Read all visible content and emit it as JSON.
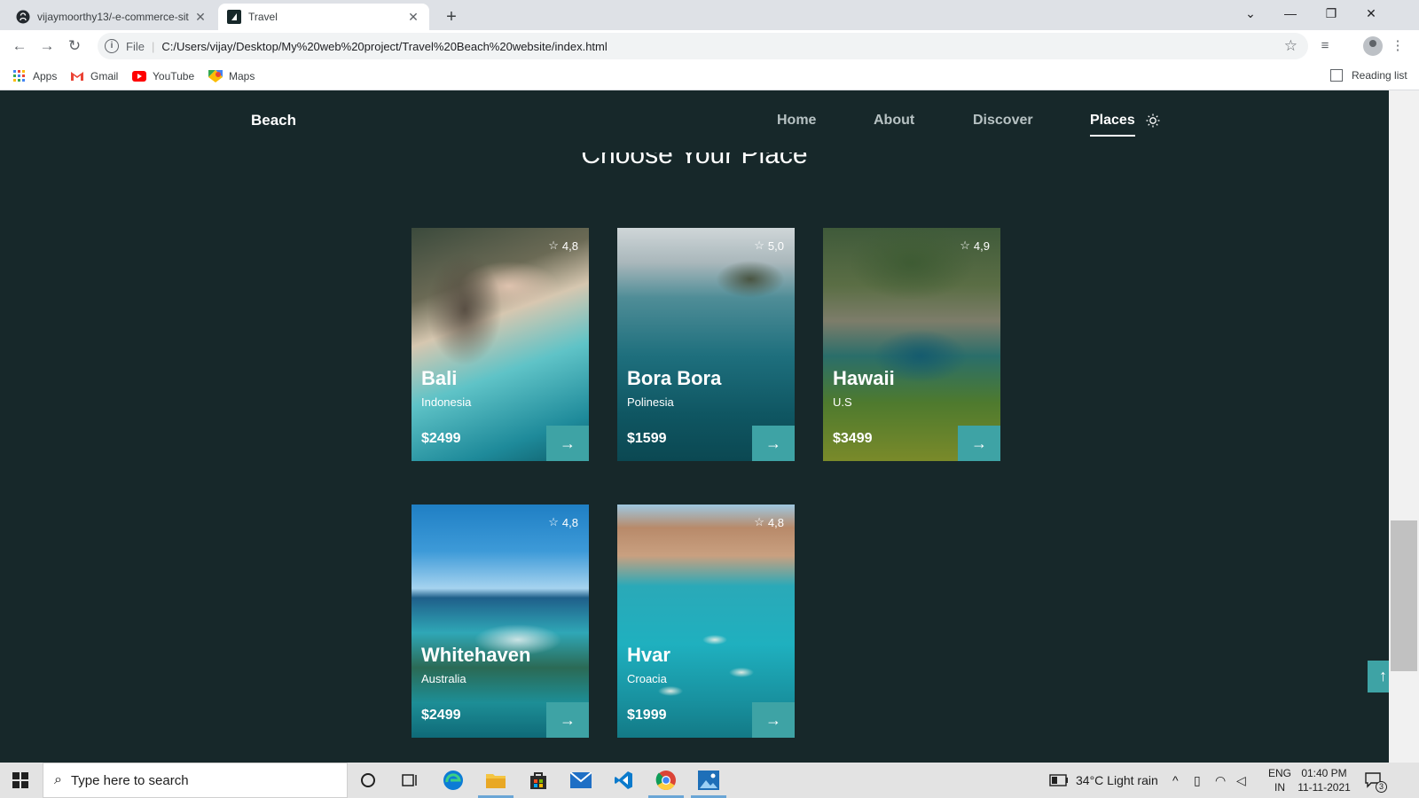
{
  "browser": {
    "tabs": [
      {
        "title": "vijaymoorthy13/-e-commerce-sit",
        "icon": "github-icon"
      },
      {
        "title": "Travel",
        "icon": "site-icon"
      }
    ],
    "address": {
      "protocol": "File",
      "url": "C:/Users/vijay/Desktop/My%20web%20project/Travel%20Beach%20website/index.html"
    },
    "bookmarks": [
      {
        "label": "Apps",
        "icon": "apps-grid-icon"
      },
      {
        "label": "Gmail",
        "icon": "gmail-icon"
      },
      {
        "label": "YouTube",
        "icon": "youtube-icon"
      },
      {
        "label": "Maps",
        "icon": "maps-icon"
      }
    ],
    "reading_list": "Reading list"
  },
  "site": {
    "logo": "Beach",
    "nav": [
      {
        "label": "Home",
        "active": false
      },
      {
        "label": "About",
        "active": false
      },
      {
        "label": "Discover",
        "active": false
      },
      {
        "label": "Places",
        "active": true
      }
    ],
    "section_title": "Choose Your Place",
    "accent_color": "#3ea3a5",
    "background_color": "#17282a",
    "places": [
      {
        "name": "Bali",
        "country": "Indonesia",
        "price": "$2499",
        "rating": "4,8"
      },
      {
        "name": "Bora Bora",
        "country": "Polinesia",
        "price": "$1599",
        "rating": "5,0"
      },
      {
        "name": "Hawaii",
        "country": "U.S",
        "price": "$3499",
        "rating": "4,9"
      },
      {
        "name": "Whitehaven",
        "country": "Australia",
        "price": "$2499",
        "rating": "4,8"
      },
      {
        "name": "Hvar",
        "country": "Croacia",
        "price": "$1999",
        "rating": "4,8"
      }
    ]
  },
  "taskbar": {
    "search_placeholder": "Type here to search",
    "weather": "34°C  Light rain",
    "language": [
      "ENG",
      "IN"
    ],
    "time": "01:40 PM",
    "date": "11-11-2021",
    "notifications": "3"
  }
}
